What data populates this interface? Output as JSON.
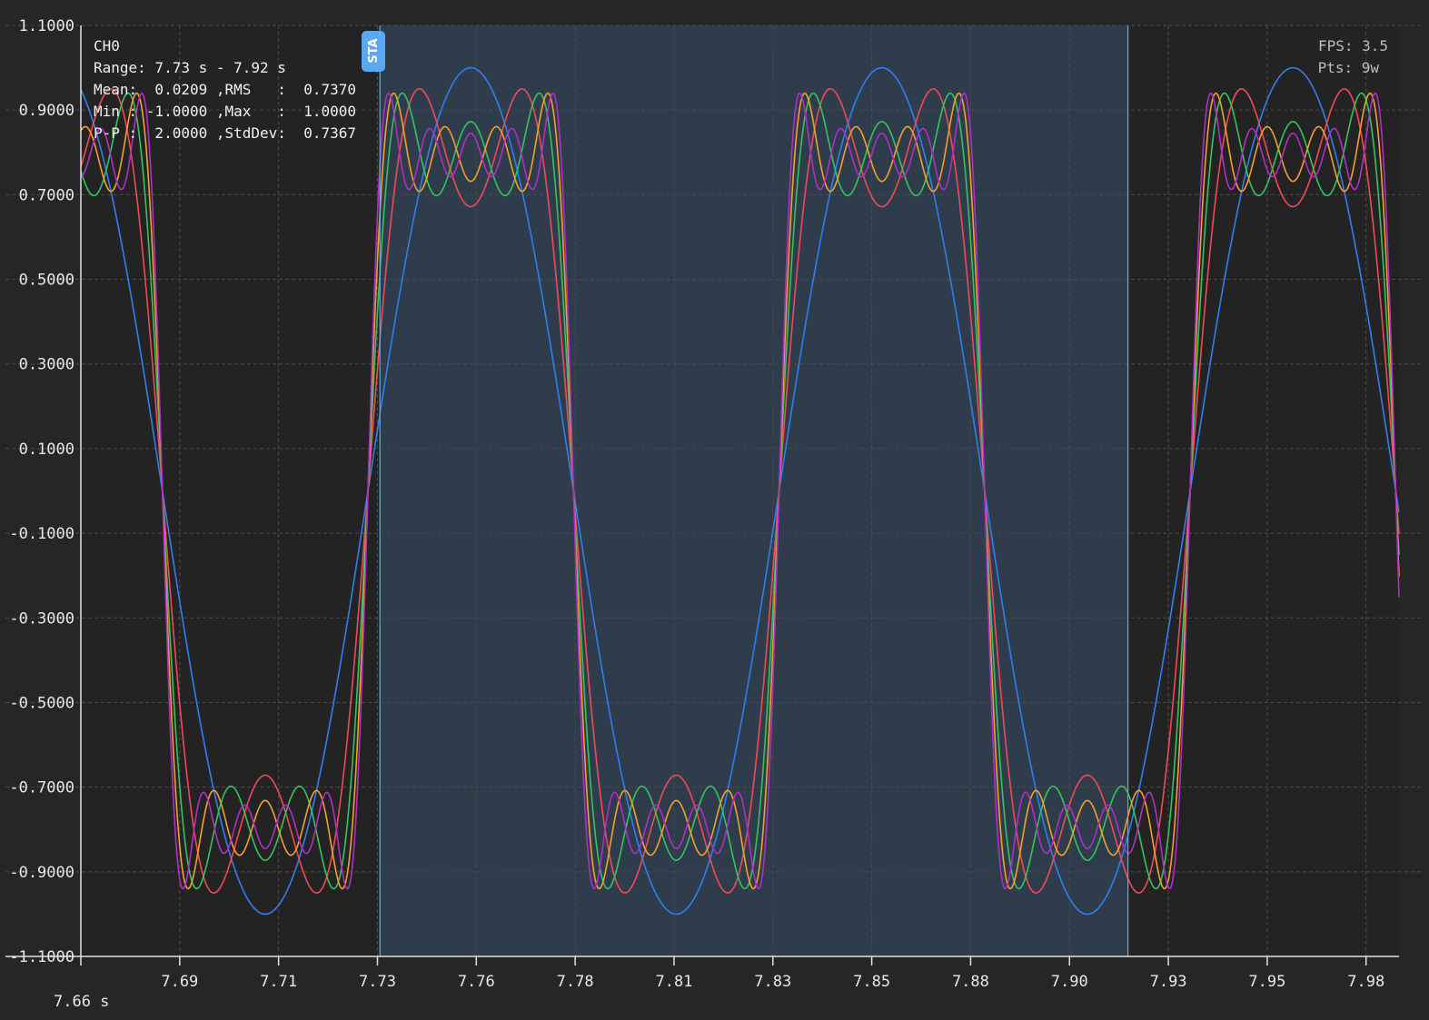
{
  "info_panel": {
    "channel": "CH0",
    "range": "Range: 7.73 s - 7.92 s",
    "line_mean_rms": "Mean:  0.0209 ,RMS   :  0.7370",
    "line_min_max": "Min : -1.0000 ,Max   :  1.0000",
    "line_pp_std": "P-P :  2.0000 ,StdDev:  0.7367"
  },
  "perf_panel": {
    "fps": "FPS: 3.5",
    "pts": "Pts: 9w"
  },
  "marker": {
    "label": "STA"
  },
  "colors": {
    "background": "#262626",
    "plot_bg": "#232323",
    "selection": "#2e3c4b",
    "selection_edge": "#6fa9d8",
    "marker_badge": "#5aa9f0",
    "grid": "#4a4a4a",
    "axis": "#e0e0e0"
  },
  "chart_data": {
    "type": "line",
    "title": "",
    "xlabel": "",
    "ylabel": "",
    "x_origin_label": "7.66 s",
    "xlim": [
      7.66,
      7.98
    ],
    "ylim": [
      -1.1,
      1.1
    ],
    "x_tick_values": [
      7.66,
      7.684,
      7.708,
      7.732,
      7.756,
      7.78,
      7.804,
      7.828,
      7.852,
      7.876,
      7.9,
      7.924,
      7.948,
      7.972
    ],
    "x_tick_labels": [
      "",
      "7.69",
      "7.71",
      "7.73",
      "7.76",
      "7.78",
      "7.81",
      "7.83",
      "7.85",
      "7.88",
      "7.90",
      "7.93",
      "7.95",
      "7.98"
    ],
    "y_ticks": [
      1.1,
      0.9,
      0.7,
      0.5,
      0.3,
      0.1,
      -0.1,
      -0.3,
      -0.5,
      -0.7,
      -0.9,
      -1.1
    ],
    "y_tick_labels": [
      "1.1000",
      "0.9000",
      "0.7000",
      "0.5000",
      "0.3000",
      "0.1000",
      "-0.1000",
      "-0.3000",
      "-0.5000",
      "-0.7000",
      "-0.9000",
      "-1.1000"
    ],
    "grid": true,
    "selection_range": [
      7.7326,
      7.9142
    ],
    "fundamental_period": 0.0998,
    "zero_crossing": 7.7297,
    "series": [
      {
        "harmonics": 1,
        "color": "#2f7ff0",
        "peak": 1.0
      },
      {
        "harmonics": 2,
        "color": "#f04a58",
        "peak": 0.95
      },
      {
        "harmonics": 3,
        "color": "#34c45c",
        "peak": 0.94
      },
      {
        "harmonics": 4,
        "color": "#f2a12a",
        "peak": 0.94
      },
      {
        "harmonics": 5,
        "color": "#b02fc4",
        "peak": 0.94
      }
    ]
  }
}
